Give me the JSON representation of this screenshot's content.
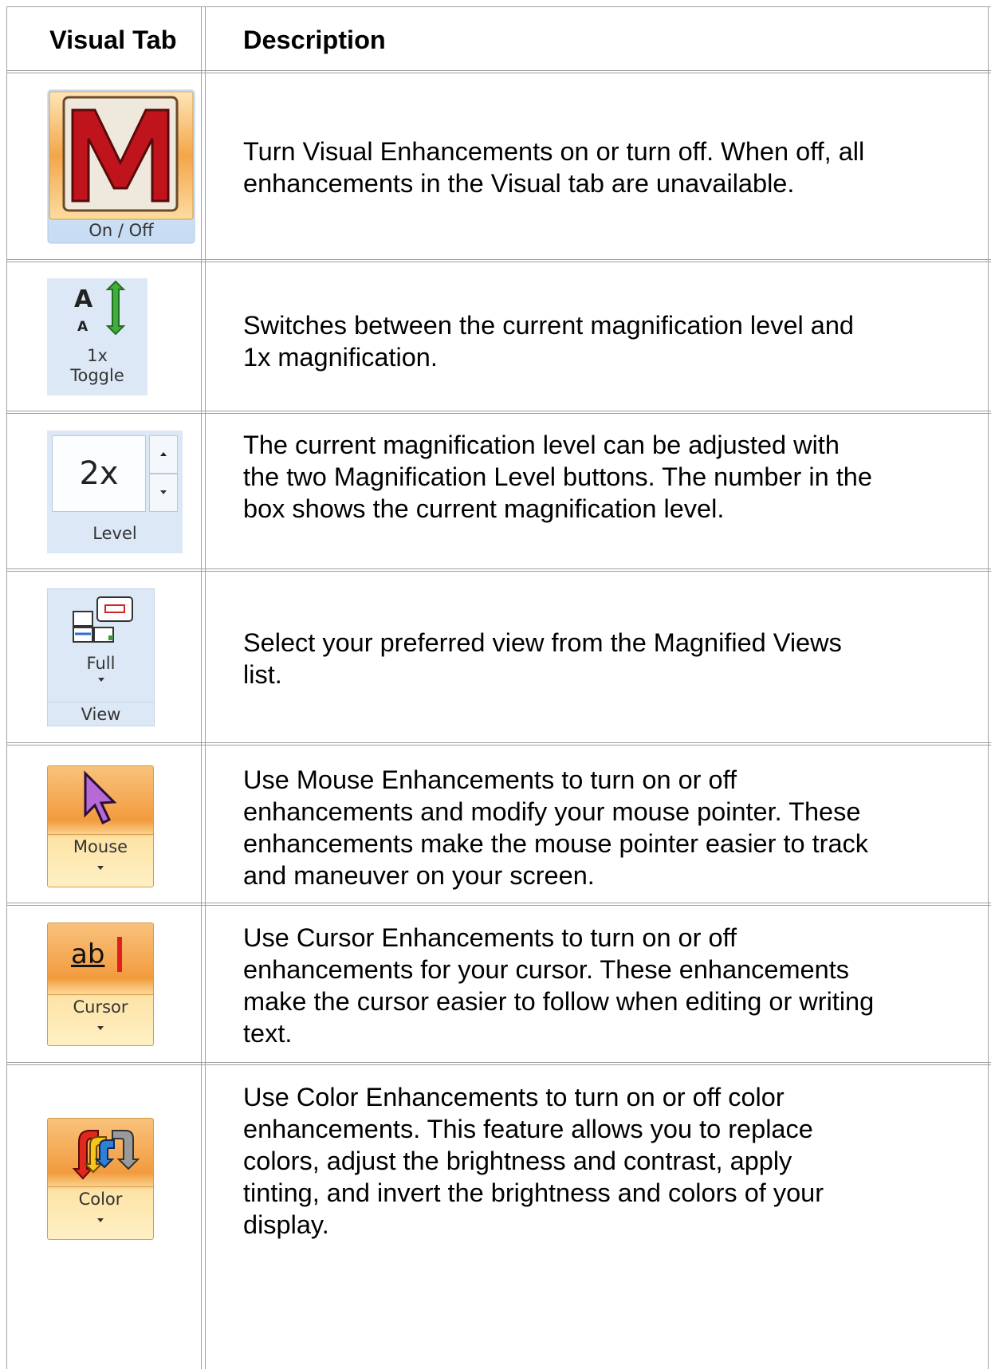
{
  "table": {
    "headers": {
      "visual_tab": "Visual Tab",
      "description": "Description"
    },
    "rows": [
      {
        "icon_label": "On / Off",
        "icon": "m-logo-icon",
        "lines": [
          "Turn Visual Enhancements on or turn off. When off, all",
          "enhancements in the Visual tab are unavailable."
        ]
      },
      {
        "icon_label_1": "1x",
        "icon_label_2": "Toggle",
        "icon": "text-size-toggle-icon",
        "lines": [
          "Switches between the current magnification level and",
          "1x magnification."
        ]
      },
      {
        "value": "2x",
        "icon_label": "Level",
        "icon": "level-spinner-icon",
        "lines": [
          "The current magnification level can be adjusted with",
          "the two Magnification Level buttons. The number in the",
          "box shows the current magnification level."
        ]
      },
      {
        "icon_label_1": "Full",
        "icon_label_2": "View",
        "icon": "view-layout-icon",
        "lines": [
          "Select your preferred view from the Magnified Views",
          "list."
        ]
      },
      {
        "icon_label": "Mouse",
        "icon": "mouse-pointer-icon",
        "lines": [
          "Use Mouse Enhancements to turn on or off",
          "enhancements and modify your mouse pointer. These",
          "enhancements make the mouse pointer easier to track",
          "and maneuver on your screen."
        ]
      },
      {
        "icon_label": "Cursor",
        "icon": "text-cursor-icon",
        "glyph": "ab",
        "lines": [
          "Use Cursor Enhancements to turn on or off",
          "enhancements for your cursor. These enhancements",
          "make the cursor easier to follow when editing or writing",
          "text."
        ]
      },
      {
        "icon_label": "Color",
        "icon": "color-arrows-icon",
        "lines": [
          "Use Color Enhancements to turn on or off color",
          "enhancements. This feature allows you to replace",
          "colors, adjust the brightness and contrast, apply",
          "tinting, and invert the brightness and colors of your",
          "display."
        ]
      }
    ]
  }
}
